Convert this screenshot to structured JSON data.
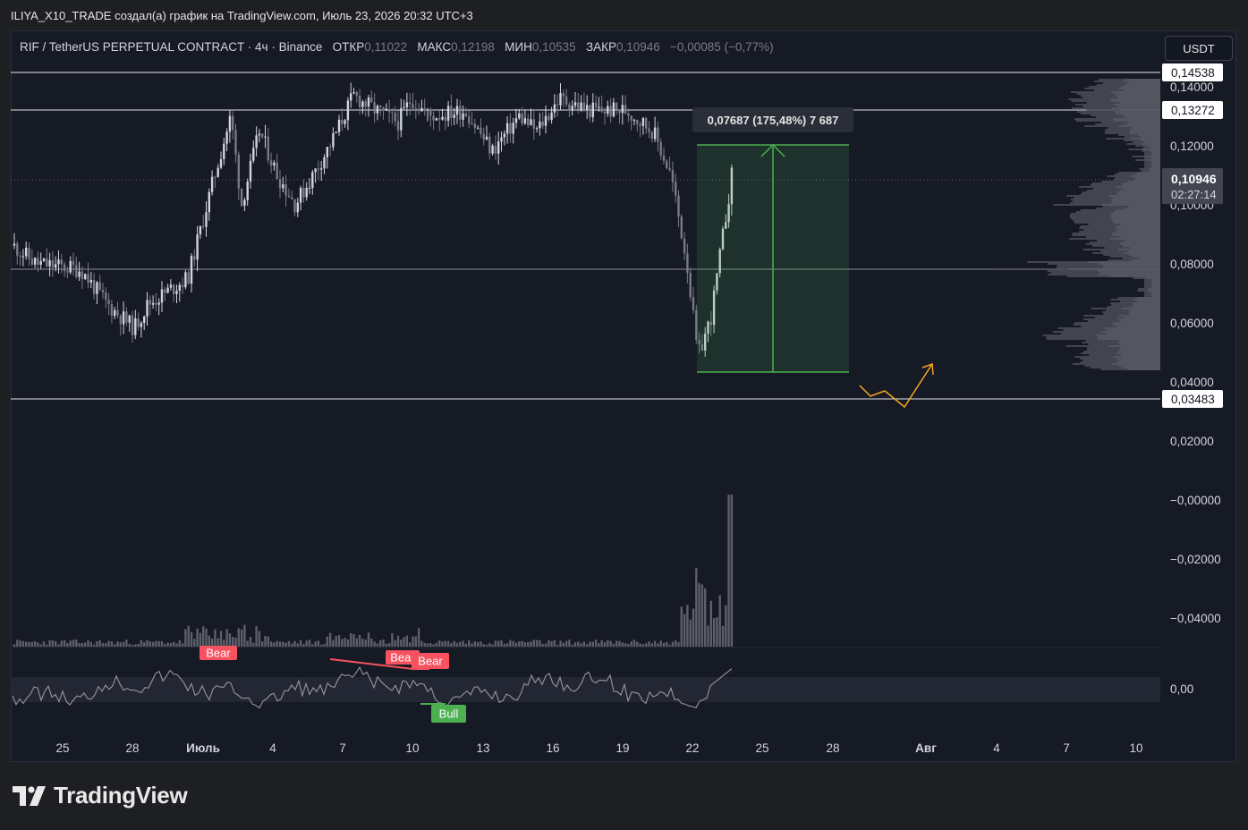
{
  "caption": "ILIYA_X10_TRADE создал(а) график на TradingView.com, Июль 23, 2026 20:32 UTC+3",
  "legend": {
    "symbol": "RIF / TetherUS PERPETUAL CONTRACT · 4ч · Binance",
    "open_label": "ОТКР",
    "open_value": "0,11022",
    "high_label": "МАКС",
    "high_value": "0,12198",
    "low_label": "МИН",
    "low_value": "0,10535",
    "close_label": "ЗАКР",
    "close_value": "0,10946",
    "change": "−0,00085 (−0,77%)"
  },
  "currency_button": "USDT",
  "price_axis": {
    "ticks": [
      "0,14000",
      "0,12000",
      "0,10000",
      "0,08000",
      "0,06000",
      "0,04000",
      "0,02000",
      "−0,00000",
      "−0,02000",
      "−0,04000"
    ],
    "labels": [
      {
        "text": "0,14538",
        "kind": "line"
      },
      {
        "text": "0,13272",
        "kind": "line"
      },
      {
        "text": "0,03483",
        "kind": "line"
      }
    ],
    "last_price": "0,10946",
    "countdown": "02:27:14"
  },
  "oscillator_axis": {
    "zero": "0,00"
  },
  "time_axis": [
    "25",
    "28",
    "Июль",
    "4",
    "7",
    "10",
    "13",
    "16",
    "19",
    "22",
    "25",
    "28",
    "Авг",
    "4",
    "7",
    "10"
  ],
  "measure_label": "0,07687 (175,48%) 7 687",
  "signals": [
    {
      "text": "Bear",
      "color": "#f7525f"
    },
    {
      "text": "Bear",
      "color": "#f7525f"
    },
    {
      "text": "Bear",
      "color": "#f7525f"
    },
    {
      "text": "Bull",
      "color": "#4caf50"
    }
  ],
  "colors": {
    "up": "#d1d4dc",
    "down": "#787b86",
    "measure": "#4caf50",
    "arrow": "#f5a623",
    "bear": "#f7525f",
    "bull": "#4caf50"
  },
  "brand": "TradingView"
}
